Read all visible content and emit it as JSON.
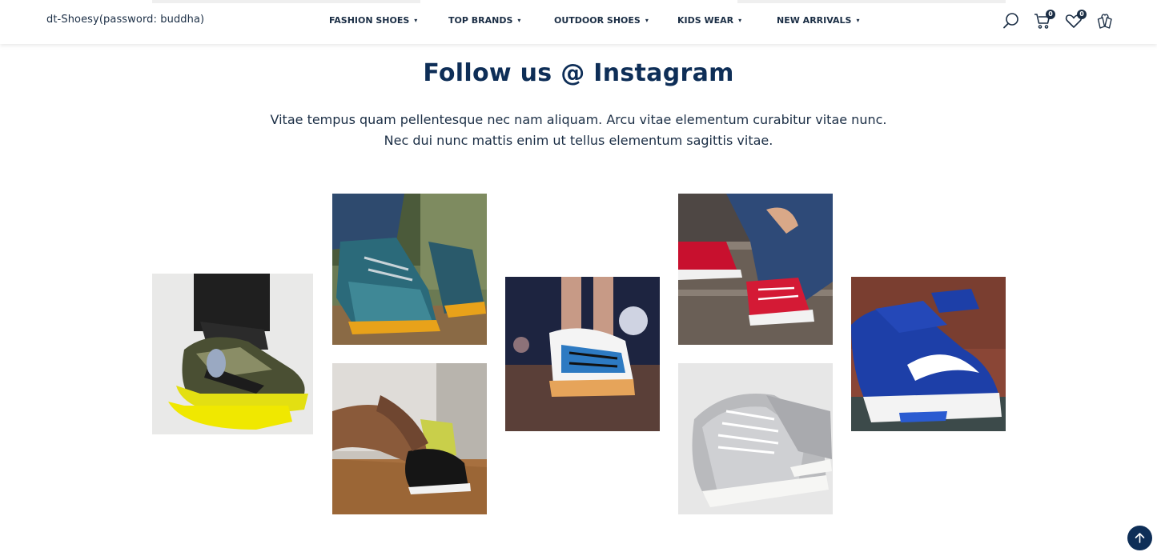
{
  "header": {
    "brand": "dt-Shoesy(password: buddha)",
    "nav": [
      {
        "label": "FASHION SHOES",
        "icon": "caret-down-icon"
      },
      {
        "label": "TOP BRANDS",
        "icon": "caret-down-icon"
      },
      {
        "label": "OUTDOOR SHOES",
        "icon": "caret-down-icon"
      },
      {
        "label": "KIDS WEAR",
        "icon": "caret-down-icon"
      },
      {
        "label": "NEW ARRIVALS",
        "icon": "caret-down-icon"
      }
    ],
    "caret_glyph": "▾",
    "icons": {
      "search": "search-icon",
      "cart": "cart-icon",
      "wishlist": "heart-icon",
      "compare": "compare-icon"
    },
    "cart_count": "0",
    "wishlist_count": "0"
  },
  "section": {
    "title": "Follow us @ Instagram",
    "description_line1": "Vitae tempus quam pellentesque nec nam aliquam. Arcu vitae elementum curabitur vitae nunc.",
    "description_line2": "Nec dui nunc mattis enim ut tellus elementum sagittis vitae."
  },
  "gallery": [
    {
      "name": "instagram-photo-yellow-sneakers"
    },
    {
      "name": "instagram-photo-hiking-boots"
    },
    {
      "name": "instagram-photo-tying-shoelace"
    },
    {
      "name": "instagram-photo-running-shoe"
    },
    {
      "name": "instagram-photo-red-sneakers"
    },
    {
      "name": "instagram-photo-silver-sneakers"
    },
    {
      "name": "instagram-photo-blue-sneakers"
    }
  ],
  "colors": {
    "heading": "#0e2e57",
    "text": "#1b2e45",
    "accent": "#0e2e57"
  },
  "back_to_top_icon": "arrow-up-icon"
}
